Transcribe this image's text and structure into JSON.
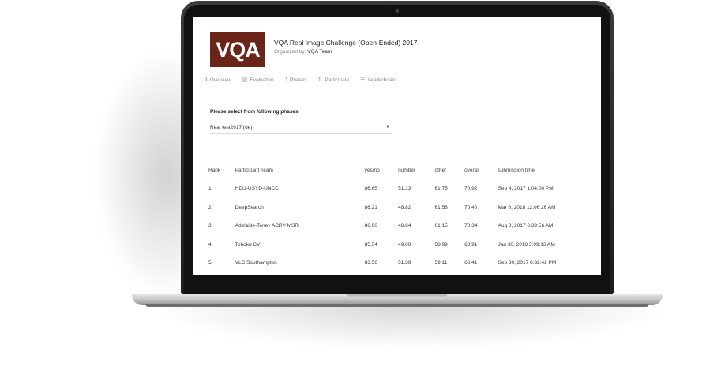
{
  "challenge": {
    "logo_text": "VQA",
    "title": "VQA Real Image Challenge (Open-Ended) 2017",
    "organized_by_label": "Organized by:",
    "organizer": "VQA Team"
  },
  "tabs": [
    {
      "icon": "info-icon",
      "glyph": "ℹ",
      "label": "Overview"
    },
    {
      "icon": "bar-chart-icon",
      "glyph": "▥",
      "label": "Evaluation"
    },
    {
      "icon": "phases-icon",
      "glyph": "⤒",
      "label": "Phases"
    },
    {
      "icon": "participate-icon",
      "glyph": "⇅",
      "label": "Participate"
    },
    {
      "icon": "list-icon",
      "glyph": "☰",
      "label": "Leaderboard"
    }
  ],
  "phase_selector": {
    "label": "Please select from following phases",
    "selected": "Real test2017 (oe)"
  },
  "leaderboard": {
    "columns": [
      "Rank",
      "Participant Team",
      "yes/no",
      "number",
      "other",
      "overall",
      "submission time"
    ],
    "rows": [
      {
        "rank": "1",
        "team": "HDU-USYD-UNCC",
        "yes_no": "86.65",
        "number": "51.13",
        "other": "61.75",
        "overall": "70.92",
        "time": "Sep 4, 2017 1:04:00 PM"
      },
      {
        "rank": "2",
        "team": "DeepSearch",
        "yes_no": "86.21",
        "number": "48.82",
        "other": "61.58",
        "overall": "70.40",
        "time": "Mar 8, 2018 12:06:26 AM"
      },
      {
        "rank": "3",
        "team": "Adelaide-Teney ACRV MSR",
        "yes_no": "86.60",
        "number": "48.64",
        "other": "61.15",
        "overall": "70.34",
        "time": "Aug 8, 2017 6:39:56 AM"
      },
      {
        "rank": "4",
        "team": "Tohoku CV",
        "yes_no": "85.54",
        "number": "49.00",
        "other": "58.99",
        "overall": "68.91",
        "time": "Jan 30, 2018 3:09:13 AM"
      },
      {
        "rank": "5",
        "team": "VLC Southampton",
        "yes_no": "83.56",
        "number": "51.39",
        "other": "59.11",
        "overall": "68.41",
        "time": "Sep 30, 2017 6:32:42 PM"
      }
    ]
  }
}
